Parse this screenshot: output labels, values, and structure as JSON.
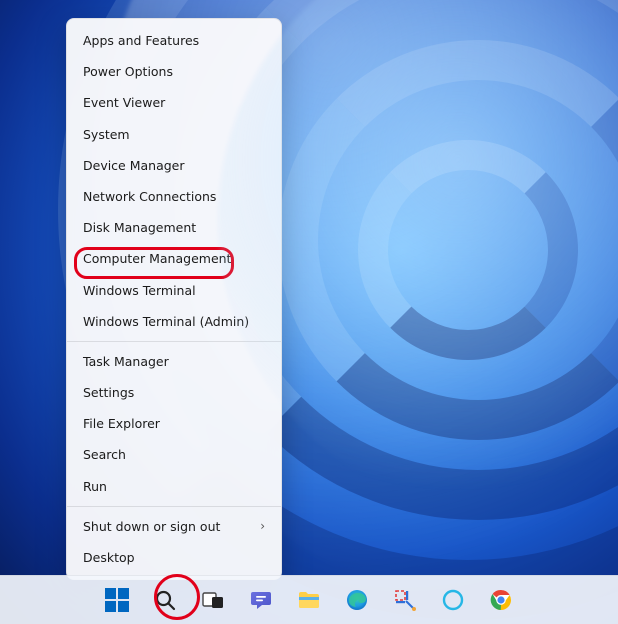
{
  "context_menu": {
    "groups": [
      [
        {
          "label": "Apps and Features",
          "submenu": false
        },
        {
          "label": "Power Options",
          "submenu": false
        },
        {
          "label": "Event Viewer",
          "submenu": false
        },
        {
          "label": "System",
          "submenu": false
        },
        {
          "label": "Device Manager",
          "submenu": false
        },
        {
          "label": "Network Connections",
          "submenu": false
        },
        {
          "label": "Disk Management",
          "submenu": false
        },
        {
          "label": "Computer Management",
          "submenu": false,
          "highlighted": true
        },
        {
          "label": "Windows Terminal",
          "submenu": false
        },
        {
          "label": "Windows Terminal (Admin)",
          "submenu": false
        }
      ],
      [
        {
          "label": "Task Manager",
          "submenu": false
        },
        {
          "label": "Settings",
          "submenu": false
        },
        {
          "label": "File Explorer",
          "submenu": false
        },
        {
          "label": "Search",
          "submenu": false
        },
        {
          "label": "Run",
          "submenu": false
        }
      ],
      [
        {
          "label": "Shut down or sign out",
          "submenu": true
        },
        {
          "label": "Desktop",
          "submenu": false
        }
      ]
    ]
  },
  "taskbar": {
    "items": [
      {
        "name": "start-button",
        "icon": "windows-logo-icon",
        "highlighted": true
      },
      {
        "name": "search-button",
        "icon": "search-icon"
      },
      {
        "name": "task-view-button",
        "icon": "task-view-icon"
      },
      {
        "name": "chat-button",
        "icon": "chat-icon"
      },
      {
        "name": "file-explorer-button",
        "icon": "file-explorer-icon"
      },
      {
        "name": "edge-button",
        "icon": "edge-icon"
      },
      {
        "name": "snipping-tool-button",
        "icon": "snip-icon"
      },
      {
        "name": "cortana-button",
        "icon": "cortana-icon"
      },
      {
        "name": "chrome-button",
        "icon": "chrome-icon"
      }
    ]
  }
}
